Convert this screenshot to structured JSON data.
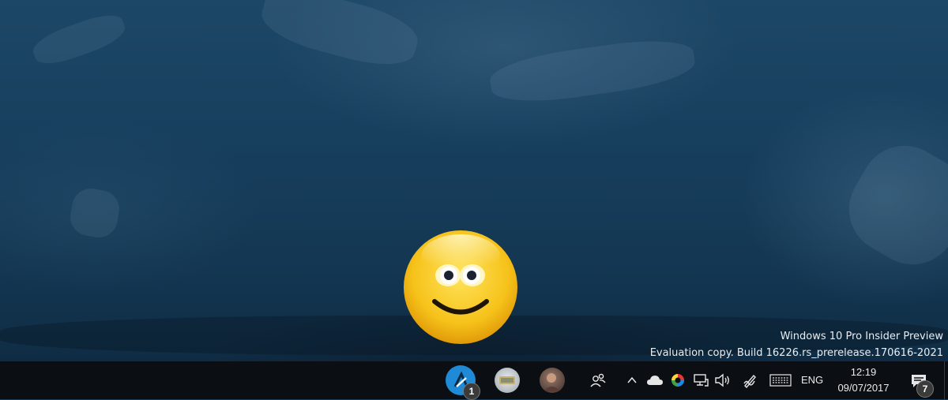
{
  "watermark": {
    "line1": "Windows 10 Pro Insider Preview",
    "line2": "Evaluation copy. Build 16226.rs_prerelease.170616-2021"
  },
  "taskbar": {
    "pinned": [
      {
        "name": "app-a-icon",
        "badge": "1"
      },
      {
        "name": "people-contact-icon",
        "badge": ""
      },
      {
        "name": "people-contact-avatar-icon",
        "badge": ""
      }
    ],
    "tray": {
      "icons": [
        "people-icon",
        "chevron-up-icon",
        "onedrive-cloud-icon",
        "color-app-icon",
        "network-icon",
        "volume-icon",
        "pen-workspace-icon",
        "touch-keyboard-icon"
      ],
      "language": "ENG",
      "time": "12:19",
      "date": "09/07/2017",
      "notifications_count": "7"
    }
  },
  "colors": {
    "taskbar": "#0b0f13",
    "desktop": "#163a57",
    "accent_blue": "#1f8ad6",
    "smiley_yellow": "#f6c21a"
  }
}
